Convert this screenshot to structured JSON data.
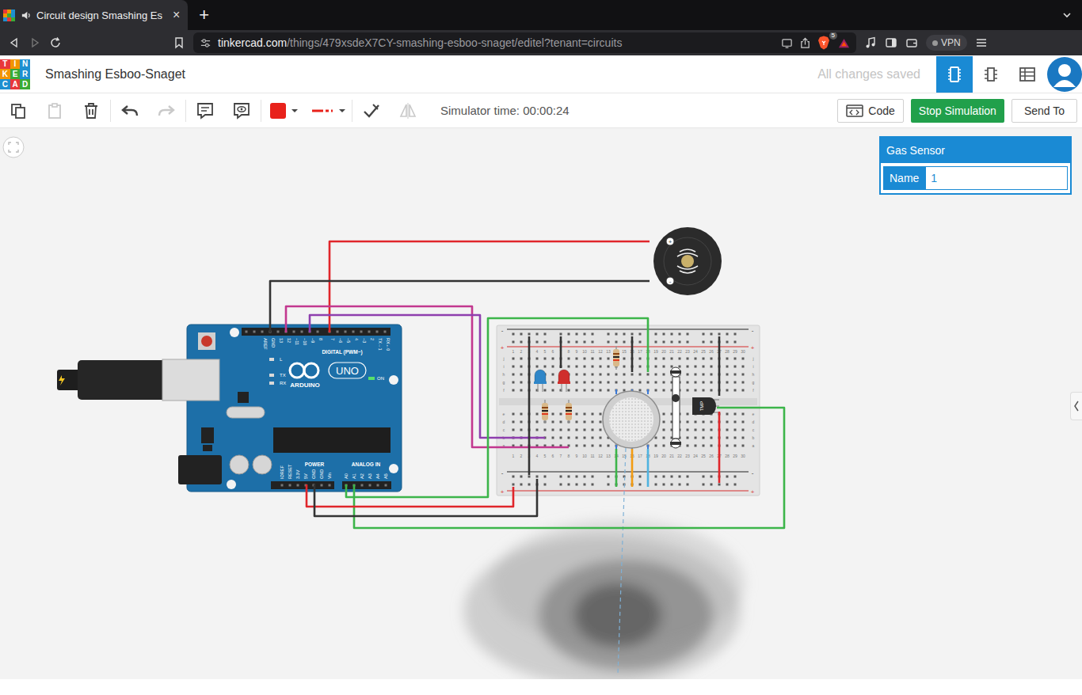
{
  "browser": {
    "tab": {
      "title": "Circuit design Smashing Es",
      "close": "×"
    },
    "new_tab": "+",
    "url": {
      "host": "tinkercad.com",
      "path": "/things/479xsdeX7CY-smashing-esboo-snaget/editel?tenant=circuits"
    },
    "shields_count": "5",
    "vpn": "VPN"
  },
  "app": {
    "logo": [
      "T",
      "I",
      "N",
      "K",
      "E",
      "R",
      "C",
      "A",
      "D"
    ],
    "title": "Smashing Esboo-Snaget",
    "save_status": "All changes saved",
    "views": [
      {
        "kind": "circuit",
        "selected": true
      },
      {
        "kind": "schematic",
        "selected": false
      },
      {
        "kind": "list",
        "selected": false
      }
    ]
  },
  "toolbar": {
    "groups": [
      [
        {
          "kind": "copy",
          "disabled": false,
          "color": ""
        },
        {
          "kind": "paste",
          "disabled": true,
          "color": ""
        },
        {
          "kind": "delete",
          "disabled": false,
          "color": ""
        }
      ],
      [
        {
          "kind": "undo",
          "disabled": false,
          "color": ""
        },
        {
          "kind": "redo",
          "disabled": true,
          "color": ""
        }
      ],
      [
        {
          "kind": "notes",
          "disabled": false,
          "color": ""
        },
        {
          "kind": "notes-view",
          "disabled": false,
          "color": ""
        }
      ],
      [
        {
          "kind": "color",
          "disabled": false,
          "color": "#e8221b"
        },
        {
          "kind": "line-style",
          "disabled": false,
          "color": "#e8221b"
        }
      ],
      [
        {
          "kind": "route",
          "disabled": false,
          "color": ""
        },
        {
          "kind": "mirror",
          "disabled": true,
          "color": ""
        }
      ]
    ],
    "simulator_time": "Simulator time: 00:00:24",
    "code_button": "Code",
    "simulation_button": "Stop Simulation",
    "send_to": "Send To"
  },
  "inspector": {
    "title": "Gas Sensor",
    "fields": [
      {
        "label": "Name",
        "value": "1"
      }
    ]
  },
  "arduino": {
    "brand": "ARDUINO",
    "model": "UNO",
    "on": "ON",
    "status_leds": [
      "L",
      "TX",
      "RX"
    ],
    "digital_title": "DIGITAL (PWM~)",
    "digital_pins": [
      "AREF",
      "GND",
      "13",
      "12",
      "~11",
      "~10",
      "~9",
      "8",
      "7",
      "~6",
      "~5",
      "4",
      "~3",
      "2",
      "TX→1",
      "RX←0"
    ],
    "power_title": "POWER",
    "power_pins": [
      "IOREF",
      "RESET",
      "3.3V",
      "5V",
      "GND",
      "GND",
      "Vin"
    ],
    "analog_title": "ANALOG IN",
    "analog_pins": [
      "A0",
      "A1",
      "A2",
      "A3",
      "A4",
      "A5"
    ]
  },
  "buzzer": {
    "plus": "+",
    "minus": "-"
  },
  "breadboard": {
    "columns": [
      "1",
      "2",
      "3",
      "4",
      "5",
      "6",
      "7",
      "8",
      "9",
      "10",
      "11",
      "12",
      "13",
      "14",
      "15",
      "16",
      "17",
      "18",
      "19",
      "20",
      "21",
      "22",
      "23",
      "24",
      "25",
      "26",
      "27",
      "28",
      "29",
      "30"
    ],
    "rows_top": [
      "j",
      "i",
      "h",
      "g",
      "f"
    ],
    "rows_bottom": [
      "e",
      "d",
      "c",
      "b",
      "a"
    ],
    "rail_signs": {
      "minus": "-",
      "plus": "+"
    }
  },
  "temperature_sensor": {
    "label": "TMP"
  },
  "leds": [
    {
      "color": "#2f86c8"
    },
    {
      "color": "#cf2f2c"
    }
  ],
  "wires": [
    {
      "color": "#e0262b"
    },
    {
      "color": "#333333"
    },
    {
      "color": "#c2388f"
    },
    {
      "color": "#8e3fae"
    },
    {
      "color": "#3cb54a"
    },
    {
      "color": "#3cb54a"
    },
    {
      "color": "#e0262b"
    },
    {
      "color": "#333333"
    },
    {
      "color": "#333333"
    },
    {
      "color": "#333333"
    },
    {
      "color": "#333333"
    },
    {
      "color": "#333333"
    },
    {
      "color": "#e0262b"
    },
    {
      "color": "#3cb54a"
    },
    {
      "color": "#f39c12"
    },
    {
      "color": "#4fb3e0"
    }
  ],
  "simulation": {
    "running": true,
    "smoke": true
  }
}
